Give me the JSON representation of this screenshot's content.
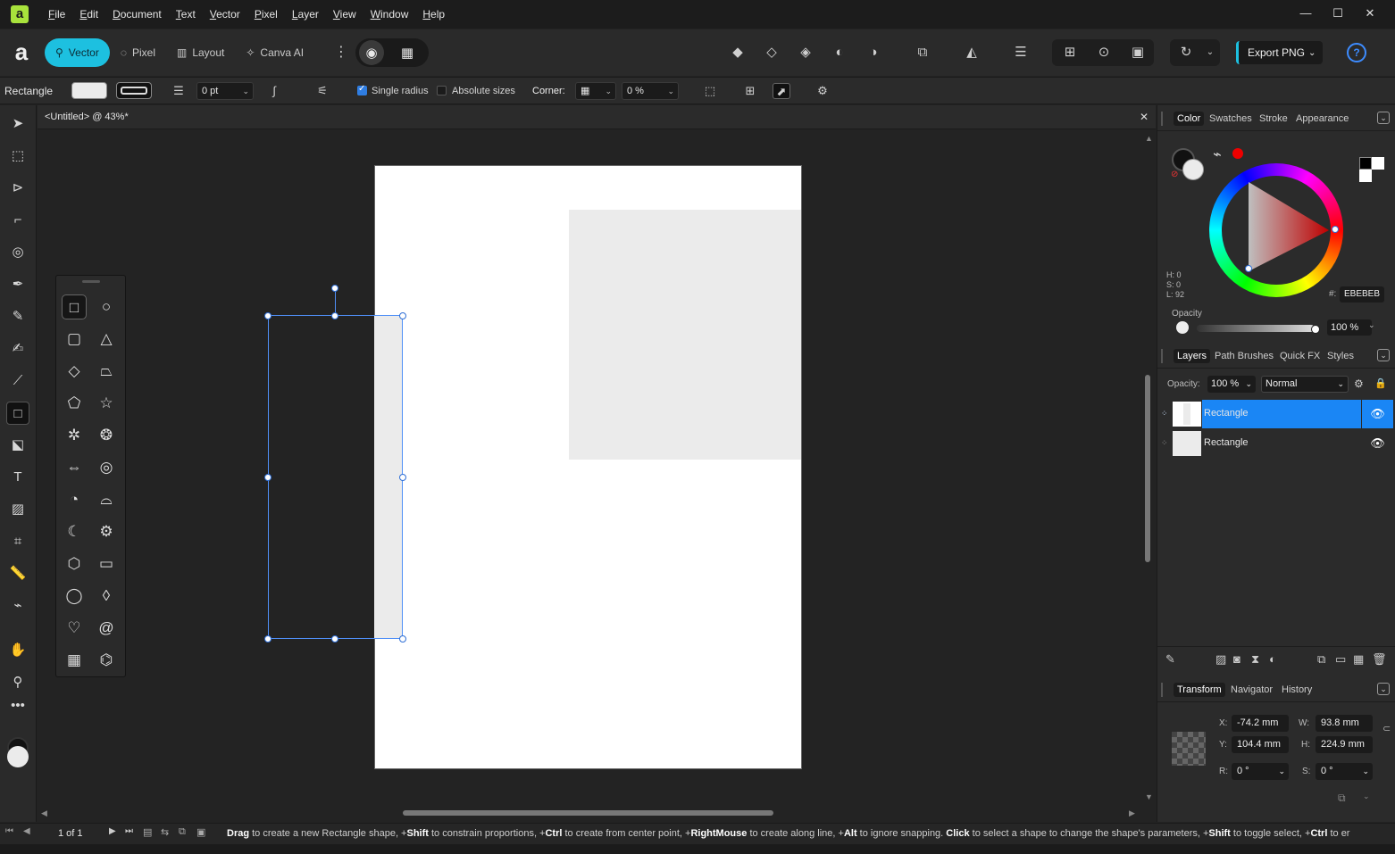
{
  "menubar": {
    "items": [
      {
        "label": "File",
        "key": "F",
        "rest": "ile"
      },
      {
        "label": "Edit",
        "key": "E",
        "rest": "dit"
      },
      {
        "label": "Document",
        "key": "D",
        "rest": "ocument"
      },
      {
        "label": "Text",
        "key": "T",
        "rest": "ext"
      },
      {
        "label": "Vector",
        "key": "V",
        "rest": "ector"
      },
      {
        "label": "Pixel",
        "key": "P",
        "rest": "ixel"
      },
      {
        "label": "Layer",
        "key": "L",
        "rest": "ayer"
      },
      {
        "label": "View",
        "key": "V",
        "rest": "iew"
      },
      {
        "label": "Window",
        "key": "W",
        "rest": "indow"
      },
      {
        "label": "Help",
        "key": "H",
        "rest": "elp"
      }
    ],
    "minimize": "—",
    "maximize": "☐",
    "close": "✕"
  },
  "toolbar": {
    "personas": [
      {
        "label": "Vector",
        "icon": "⚲"
      },
      {
        "label": "Pixel",
        "icon": "◌"
      },
      {
        "label": "Layout",
        "icon": "▥"
      },
      {
        "label": "Canva AI",
        "icon": "✧"
      }
    ],
    "export_label": "Export PNG"
  },
  "context": {
    "tool_name": "Rectangle",
    "stroke_width": "0 pt",
    "single_radius_label": "Single radius",
    "absolute_sizes_label": "Absolute sizes",
    "corner_label": "Corner:",
    "corner_value": "0 %"
  },
  "document": {
    "title": "<Untitled> @ 43%*",
    "close": "✕"
  },
  "color_panel": {
    "tabs": [
      "Color",
      "Swatches",
      "Stroke",
      "Appearance"
    ],
    "h": "H: 0",
    "s": "S: 0",
    "l": "L: 92",
    "hex_label": "#:",
    "hex": "EBEBEB",
    "opacity_label": "Opacity",
    "opacity_value": "100 %",
    "fill_color": "#ebebeb",
    "accent_color": "#1dc0e0"
  },
  "layers_panel": {
    "tabs": [
      "Layers",
      "Path Brushes",
      "Quick FX",
      "Styles"
    ],
    "opacity_label": "Opacity:",
    "opacity_value": "100 %",
    "blend_mode": "Normal",
    "layers": [
      {
        "name": "Rectangle",
        "selected": true
      },
      {
        "name": "Rectangle",
        "selected": false
      }
    ],
    "selection_color": "#1a86f5"
  },
  "transform_panel": {
    "tabs": [
      "Transform",
      "Navigator",
      "History"
    ],
    "x_label": "X:",
    "x": "-74.2 mm",
    "y_label": "Y:",
    "y": "104.4 mm",
    "w_label": "W:",
    "w": "93.8 mm",
    "h_label": "H:",
    "h": "224.9 mm",
    "r_label": "R:",
    "r": "0 °",
    "s_label": "S:",
    "s": "0 °"
  },
  "status": {
    "pages": "1 of 1",
    "hint_parts": [
      {
        "b": "Drag",
        "t": " to create a new Rectangle shape, +"
      },
      {
        "b": "Shift",
        "t": " to constrain proportions, +"
      },
      {
        "b": "Ctrl",
        "t": " to create from center point, +"
      },
      {
        "b": "RightMouse",
        "t": " to create along line, +"
      },
      {
        "b": "Alt",
        "t": " to ignore snapping. "
      },
      {
        "b": "Click",
        "t": " to select a shape to change the shape's parameters, +"
      },
      {
        "b": "Shift",
        "t": " to toggle select, +"
      },
      {
        "b": "Ctrl",
        "t": " to er"
      }
    ]
  }
}
